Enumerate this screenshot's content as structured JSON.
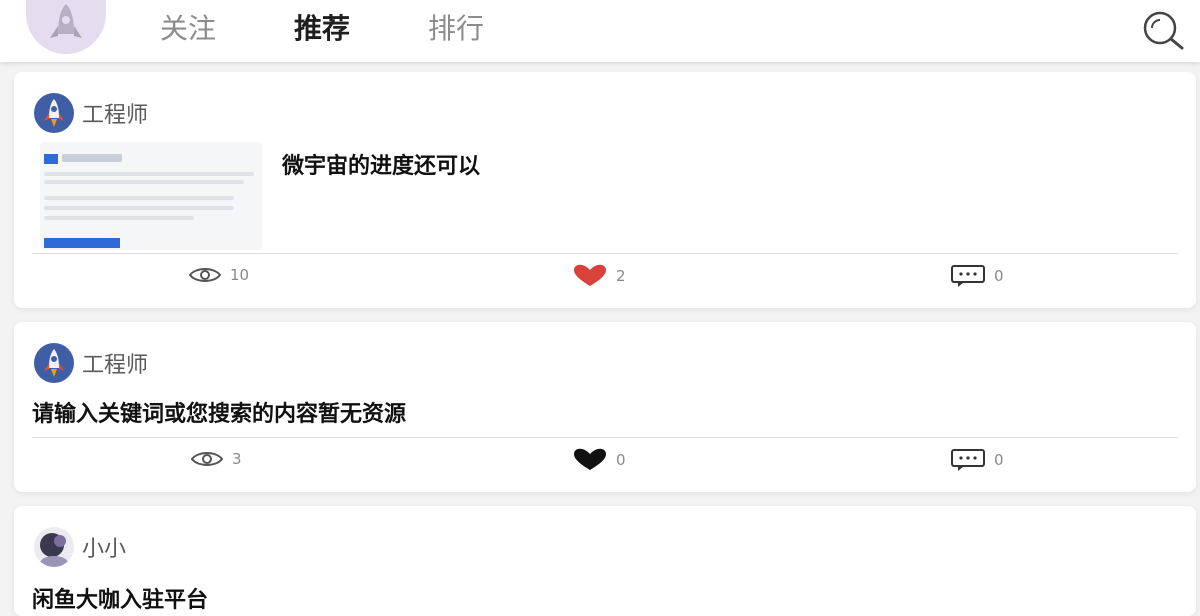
{
  "tabs": [
    {
      "label": "关注",
      "active": false
    },
    {
      "label": "推荐",
      "active": true
    },
    {
      "label": "排行",
      "active": false
    }
  ],
  "posts": [
    {
      "author": "工程师",
      "title": "微宇宙的进度还可以",
      "views": "10",
      "likes": "2",
      "comments": "0",
      "liked": true
    },
    {
      "author": "工程师",
      "title": "请输入关键词或您搜索的内容暂无资源",
      "views": "3",
      "likes": "0",
      "comments": "0",
      "liked": false
    },
    {
      "author": "小小",
      "title": "闲鱼大咖入驻平台"
    }
  ],
  "icons": {
    "top_avatar": "rocket-avatar-icon",
    "search": "search-icon",
    "views": "eye-icon",
    "likes": "heart-icon",
    "comments": "comment-icon"
  },
  "colors": {
    "liked_heart": "#d9413b",
    "unliked_heart": "#111111",
    "avatar_bg": "#3f5ea6"
  }
}
